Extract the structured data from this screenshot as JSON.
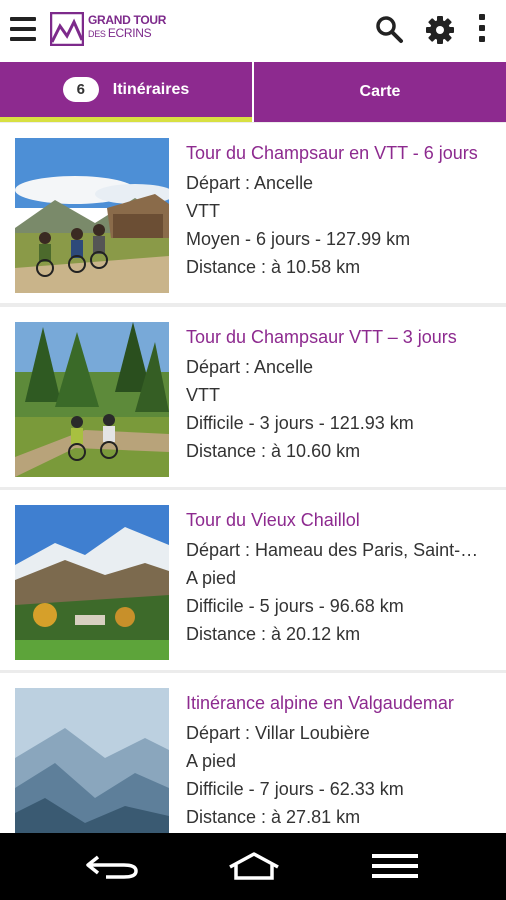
{
  "app": {
    "logo_line1": "GRAND TOUR",
    "logo_line2": "ECRINS"
  },
  "toolbar": {
    "menu_icon": "menu-icon",
    "search_icon": "search-icon",
    "settings_icon": "gear-icon",
    "more_icon": "more-vertical-icon"
  },
  "tabs": [
    {
      "label": "Itinéraires",
      "count": "6",
      "active": true
    },
    {
      "label": "Carte",
      "active": false
    }
  ],
  "items": [
    {
      "title": "Tour du Champsaur en VTT - 6 jours",
      "depart": "Départ : Ancelle",
      "activity": "VTT",
      "details": "Moyen - 6 jours - 127.99 km",
      "distance": "Distance : à 10.58 km"
    },
    {
      "title": "Tour du Champsaur VTT – 3 jours",
      "depart": "Départ : Ancelle",
      "activity": "VTT",
      "details": "Difficile - 3 jours - 121.93 km",
      "distance": "Distance : à 10.60 km"
    },
    {
      "title": "Tour du Vieux Chaillol",
      "depart": "Départ : Hameau des Paris, Saint-Michel",
      "activity": "A pied",
      "details": "Difficile - 5 jours - 96.68 km",
      "distance": "Distance : à 20.12 km"
    },
    {
      "title": "Itinérance alpine en Valgaudemar",
      "depart": "Départ : Villar Loubière",
      "activity": "A pied",
      "details": "Difficile - 7 jours - 62.33 km",
      "distance": "Distance : à 27.81 km"
    }
  ],
  "navbar": {
    "back_icon": "back-icon",
    "home_icon": "home-icon",
    "recents_icon": "menu-lines-icon"
  },
  "colors": {
    "brand": "#8d2a8f",
    "tab_indicator": "#d8e042"
  }
}
